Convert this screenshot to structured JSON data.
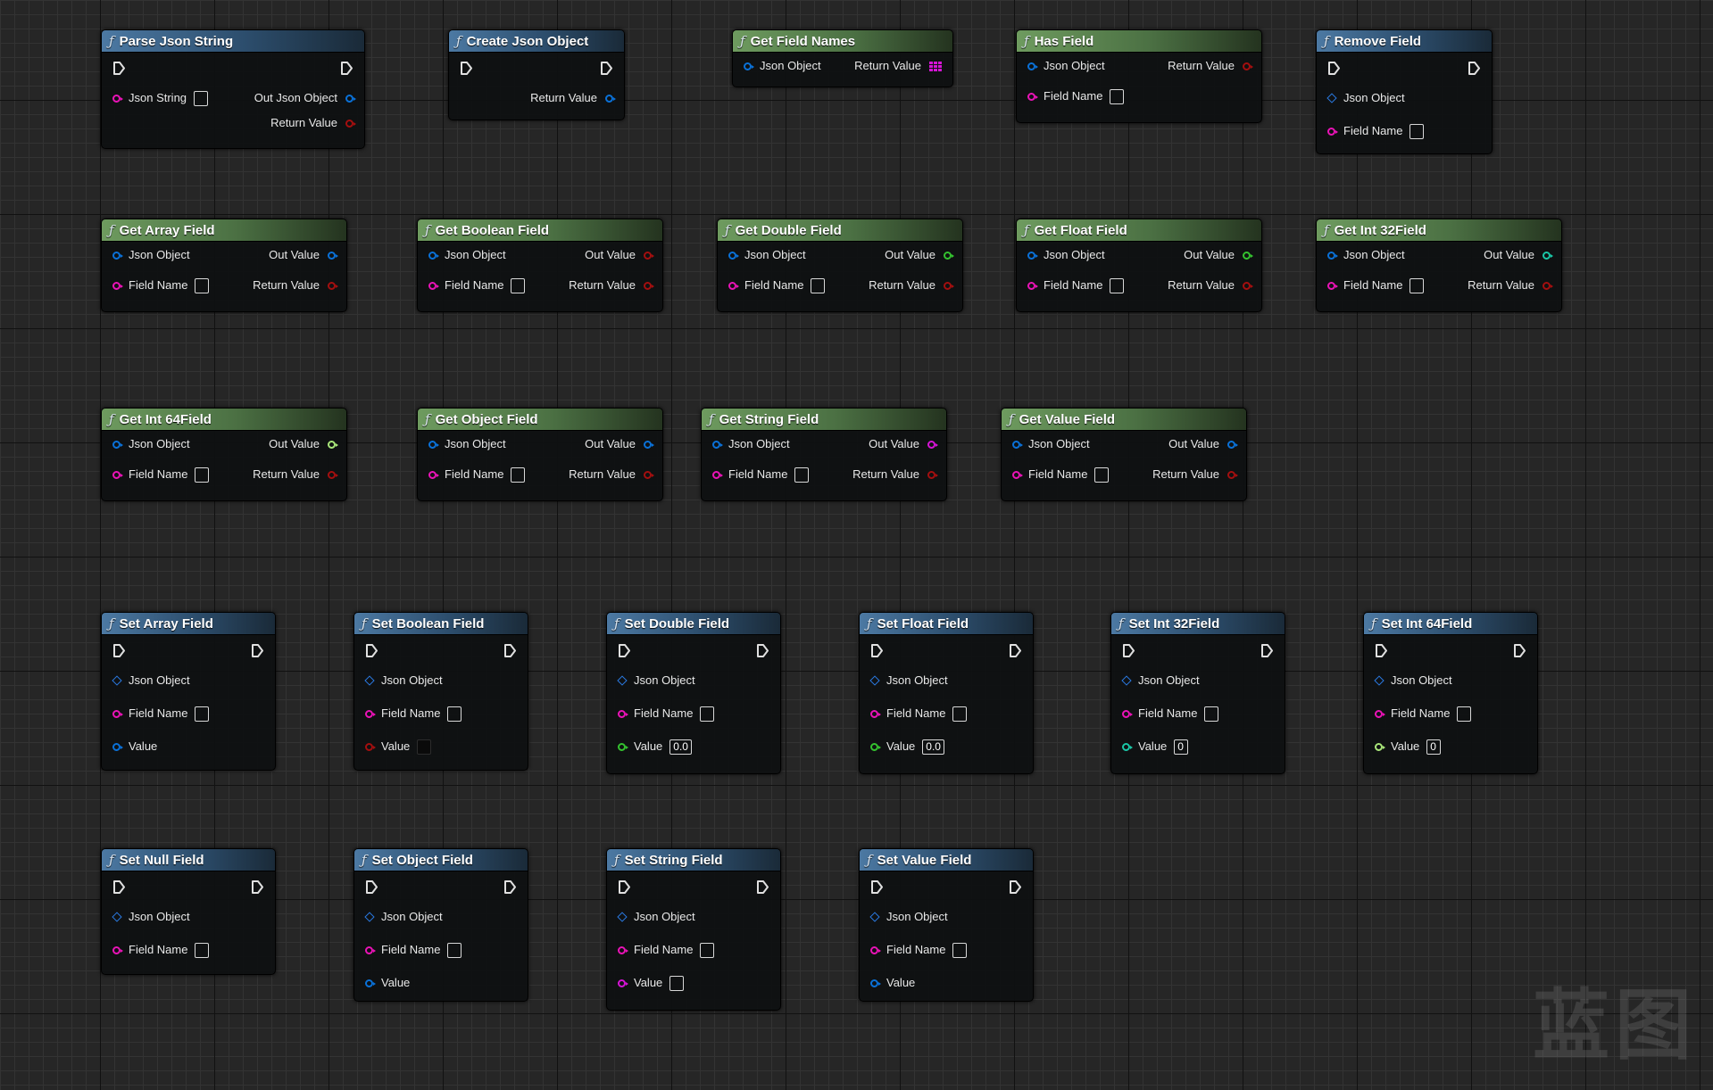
{
  "nodes": [
    {
      "title": "Parse Json String",
      "type": "impure",
      "exec": true,
      "left": [
        {
          "label": "Json String",
          "pin": "c-pink",
          "input": "box"
        }
      ],
      "right": [
        {
          "label": "Out Json Object",
          "pin": "c-blue"
        },
        {
          "label": "Return Value",
          "pin": "c-red"
        }
      ]
    },
    {
      "title": "Create Json Object",
      "type": "impure",
      "exec": true,
      "left": [],
      "right": [
        {
          "label": "Return Value",
          "pin": "c-blue"
        }
      ]
    },
    {
      "title": "Get Field Names",
      "type": "pure",
      "exec": false,
      "left": [
        {
          "label": "Json Object",
          "pin": "c-blue"
        }
      ],
      "right": [
        {
          "label": "Return Value",
          "pin": "array"
        }
      ]
    },
    {
      "title": "Has Field",
      "type": "pure",
      "exec": false,
      "left": [
        {
          "label": "Json Object",
          "pin": "c-blue"
        },
        {
          "label": "Field Name",
          "pin": "c-pink",
          "input": "box"
        }
      ],
      "right": [
        {
          "label": "Return Value",
          "pin": "c-red"
        }
      ]
    },
    {
      "title": "Remove Field",
      "type": "impure",
      "exec": true,
      "left": [
        {
          "label": "Json Object",
          "pin": "diamond"
        },
        {
          "label": "Field Name",
          "pin": "c-pink",
          "input": "box"
        }
      ],
      "right": []
    },
    {
      "title": "Get Array Field",
      "type": "pure",
      "exec": false,
      "left": [
        {
          "label": "Json Object",
          "pin": "c-blue"
        },
        {
          "label": "Field Name",
          "pin": "c-pink",
          "input": "box"
        }
      ],
      "right": [
        {
          "label": "Out Value",
          "pin": "c-blue"
        },
        {
          "label": "Return Value",
          "pin": "c-red"
        }
      ]
    },
    {
      "title": "Get Boolean Field",
      "type": "pure",
      "exec": false,
      "left": [
        {
          "label": "Json Object",
          "pin": "c-blue"
        },
        {
          "label": "Field Name",
          "pin": "c-pink",
          "input": "box"
        }
      ],
      "right": [
        {
          "label": "Out Value",
          "pin": "c-red"
        },
        {
          "label": "Return Value",
          "pin": "c-red"
        }
      ]
    },
    {
      "title": "Get Double Field",
      "type": "pure",
      "exec": false,
      "left": [
        {
          "label": "Json Object",
          "pin": "c-blue"
        },
        {
          "label": "Field Name",
          "pin": "c-pink",
          "input": "box"
        }
      ],
      "right": [
        {
          "label": "Out Value",
          "pin": "c-green"
        },
        {
          "label": "Return Value",
          "pin": "c-red"
        }
      ]
    },
    {
      "title": "Get Float Field",
      "type": "pure",
      "exec": false,
      "left": [
        {
          "label": "Json Object",
          "pin": "c-blue"
        },
        {
          "label": "Field Name",
          "pin": "c-pink",
          "input": "box"
        }
      ],
      "right": [
        {
          "label": "Out Value",
          "pin": "c-green"
        },
        {
          "label": "Return Value",
          "pin": "c-red"
        }
      ]
    },
    {
      "title": "Get Int 32Field",
      "type": "pure",
      "exec": false,
      "left": [
        {
          "label": "Json Object",
          "pin": "c-blue"
        },
        {
          "label": "Field Name",
          "pin": "c-pink",
          "input": "box"
        }
      ],
      "right": [
        {
          "label": "Out Value",
          "pin": "c-teal"
        },
        {
          "label": "Return Value",
          "pin": "c-red"
        }
      ]
    },
    {
      "title": "Get Int 64Field",
      "type": "pure",
      "exec": false,
      "left": [
        {
          "label": "Json Object",
          "pin": "c-blue"
        },
        {
          "label": "Field Name",
          "pin": "c-pink",
          "input": "box"
        }
      ],
      "right": [
        {
          "label": "Out Value",
          "pin": "c-lime"
        },
        {
          "label": "Return Value",
          "pin": "c-red"
        }
      ]
    },
    {
      "title": "Get Object Field",
      "type": "pure",
      "exec": false,
      "left": [
        {
          "label": "Json Object",
          "pin": "c-blue"
        },
        {
          "label": "Field Name",
          "pin": "c-pink",
          "input": "box"
        }
      ],
      "right": [
        {
          "label": "Out Value",
          "pin": "c-blue"
        },
        {
          "label": "Return Value",
          "pin": "c-red"
        }
      ]
    },
    {
      "title": "Get String Field",
      "type": "pure",
      "exec": false,
      "left": [
        {
          "label": "Json Object",
          "pin": "c-blue"
        },
        {
          "label": "Field Name",
          "pin": "c-pink",
          "input": "box"
        }
      ],
      "right": [
        {
          "label": "Out Value",
          "pin": "c-purple"
        },
        {
          "label": "Return Value",
          "pin": "c-red"
        }
      ]
    },
    {
      "title": "Get Value Field",
      "type": "pure",
      "exec": false,
      "left": [
        {
          "label": "Json Object",
          "pin": "c-blue"
        },
        {
          "label": "Field Name",
          "pin": "c-pink",
          "input": "box"
        }
      ],
      "right": [
        {
          "label": "Out Value",
          "pin": "c-blue"
        },
        {
          "label": "Return Value",
          "pin": "c-red"
        }
      ]
    },
    {
      "title": "Set Array Field",
      "type": "impure",
      "exec": true,
      "left": [
        {
          "label": "Json Object",
          "pin": "diamond"
        },
        {
          "label": "Field Name",
          "pin": "c-pink",
          "input": "box"
        },
        {
          "label": "Value",
          "pin": "c-blue"
        }
      ],
      "right": []
    },
    {
      "title": "Set Boolean Field",
      "type": "impure",
      "exec": true,
      "left": [
        {
          "label": "Json Object",
          "pin": "diamond"
        },
        {
          "label": "Field Name",
          "pin": "c-pink",
          "input": "box"
        },
        {
          "label": "Value",
          "pin": "c-red",
          "input": "dark"
        }
      ],
      "right": []
    },
    {
      "title": "Set Double Field",
      "type": "impure",
      "exec": true,
      "left": [
        {
          "label": "Json Object",
          "pin": "diamond"
        },
        {
          "label": "Field Name",
          "pin": "c-pink",
          "input": "box"
        },
        {
          "label": "Value",
          "pin": "c-green",
          "input": "box",
          "value": "0.0"
        }
      ],
      "right": []
    },
    {
      "title": "Set Float Field",
      "type": "impure",
      "exec": true,
      "left": [
        {
          "label": "Json Object",
          "pin": "diamond"
        },
        {
          "label": "Field Name",
          "pin": "c-pink",
          "input": "box"
        },
        {
          "label": "Value",
          "pin": "c-green",
          "input": "box",
          "value": "0.0"
        }
      ],
      "right": []
    },
    {
      "title": "Set Int 32Field",
      "type": "impure",
      "exec": true,
      "left": [
        {
          "label": "Json Object",
          "pin": "diamond"
        },
        {
          "label": "Field Name",
          "pin": "c-pink",
          "input": "box"
        },
        {
          "label": "Value",
          "pin": "c-teal",
          "input": "box",
          "value": "0"
        }
      ],
      "right": []
    },
    {
      "title": "Set Int 64Field",
      "type": "impure",
      "exec": true,
      "left": [
        {
          "label": "Json Object",
          "pin": "diamond"
        },
        {
          "label": "Field Name",
          "pin": "c-pink",
          "input": "box"
        },
        {
          "label": "Value",
          "pin": "c-lime",
          "input": "box",
          "value": "0"
        }
      ],
      "right": []
    },
    {
      "title": "Set Null Field",
      "type": "impure",
      "exec": true,
      "left": [
        {
          "label": "Json Object",
          "pin": "diamond"
        },
        {
          "label": "Field Name",
          "pin": "c-pink",
          "input": "box"
        }
      ],
      "right": []
    },
    {
      "title": "Set Object Field",
      "type": "impure",
      "exec": true,
      "left": [
        {
          "label": "Json Object",
          "pin": "diamond"
        },
        {
          "label": "Field Name",
          "pin": "c-pink",
          "input": "box"
        },
        {
          "label": "Value",
          "pin": "c-blue"
        }
      ],
      "right": []
    },
    {
      "title": "Set String Field",
      "type": "impure",
      "exec": true,
      "left": [
        {
          "label": "Json Object",
          "pin": "diamond"
        },
        {
          "label": "Field Name",
          "pin": "c-pink",
          "input": "box"
        },
        {
          "label": "Value",
          "pin": "c-purple",
          "input": "box"
        }
      ],
      "right": []
    },
    {
      "title": "Set Value Field",
      "type": "impure",
      "exec": true,
      "left": [
        {
          "label": "Json Object",
          "pin": "diamond"
        },
        {
          "label": "Field Name",
          "pin": "c-pink",
          "input": "box"
        },
        {
          "label": "Value",
          "pin": "c-blue"
        }
      ],
      "right": []
    }
  ],
  "watermark": "蓝图",
  "colors": {
    "impure_header": "#4c79a3",
    "pure_header": "#6e9b5f",
    "object_pin": "#0a71d8",
    "string_pin": "#ea13b7",
    "bool_pin": "#a40f0f",
    "float_pin": "#34c22f",
    "int_pin": "#1ac7a7",
    "int64_pin": "#a9e67a",
    "wildcard_pin": "#d614d6"
  }
}
